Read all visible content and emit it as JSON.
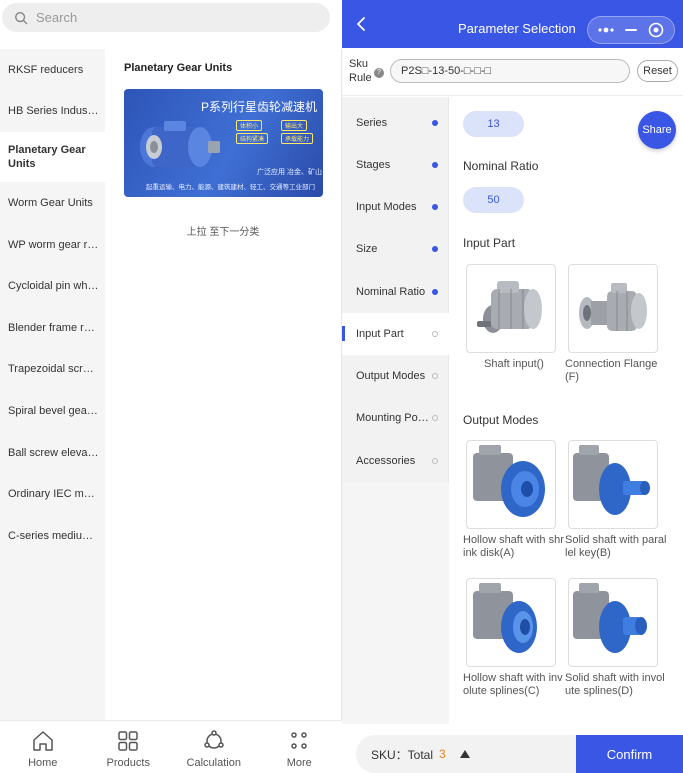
{
  "search": {
    "placeholder": "Search"
  },
  "categories": [
    "RKSF reducers",
    "HB Series Industrial Gearbox",
    "Planetary Gear Units",
    "Worm Gear Units",
    "WP worm gear reducer",
    "Cycloidal pin wheel reducer",
    "Blender frame reducer",
    "Trapezoidal screw lift",
    "Spiral bevel gear lift",
    "Ball screw elevator",
    "Ordinary IEC motor",
    "C-series medium reducer"
  ],
  "content": {
    "title": "Planetary Gear Units",
    "card": {
      "title": "P系列行星齿轮减速机",
      "tags": [
        "体积小",
        "输出大",
        "结构紧凑",
        "承载能力"
      ],
      "line1": "广泛应用   冶金、矿山",
      "line2": "起重运输、电力、能源、建筑建材、轻工、交通等工业部门"
    },
    "pull_hint": "上拉 至下一分类"
  },
  "bottom_nav": [
    {
      "label": "Home",
      "icon": "home-icon"
    },
    {
      "label": "Products",
      "icon": "grid-icon"
    },
    {
      "label": "Calculation",
      "icon": "calculation-icon"
    },
    {
      "label": "More",
      "icon": "more-icon"
    }
  ],
  "panel": {
    "title": "Parameter Selection",
    "sku_rule_label": "Sku Rule",
    "sku_rule_value": "P2S□-13-50-□-□-□",
    "reset_label": "Reset",
    "share_label": "Share",
    "nav": [
      {
        "label": "Series",
        "done": true
      },
      {
        "label": "Stages",
        "done": true
      },
      {
        "label": "Input Modes",
        "done": true
      },
      {
        "label": "Size",
        "done": true
      },
      {
        "label": "Nominal Ratio",
        "done": true
      },
      {
        "label": "Input Part",
        "done": false
      },
      {
        "label": "Output Modes",
        "done": false
      },
      {
        "label": "Mounting Position",
        "done": false
      },
      {
        "label": "Accessories",
        "done": false
      }
    ],
    "size_value": "13",
    "nominal_ratio_title": "Nominal Ratio",
    "nominal_ratio_value": "50",
    "input_part_title": "Input Part",
    "input_parts": [
      "Shaft input()",
      "Connection Flange(F)"
    ],
    "output_modes_title": "Output Modes",
    "output_modes": [
      "Hollow shaft with shrink disk(A)",
      "Solid shaft with parallel key(B)",
      "Hollow shaft with involute splines(C)",
      "Solid shaft with involute splines(D)"
    ],
    "sku_label": "SKU：Total",
    "sku_count": "3",
    "confirm_label": "Confirm"
  },
  "colors": {
    "accent": "#3a56e4",
    "chip_bg": "#dbe3fb",
    "count": "#e8861c"
  }
}
